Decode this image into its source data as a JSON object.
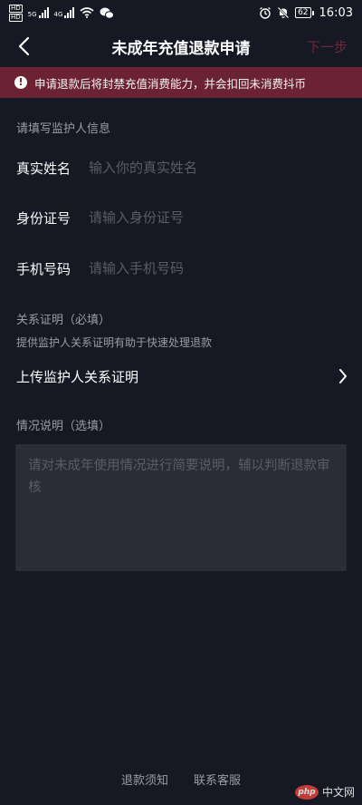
{
  "status_bar": {
    "left_tags": [
      "HD",
      "HD"
    ],
    "network_left": "5G",
    "network_right": "4G",
    "battery": "62",
    "time": "16:03",
    "icons": [
      "signal-icon",
      "wifi-icon",
      "wechat-icon",
      "alarm-icon",
      "mute-icon",
      "battery-icon"
    ]
  },
  "nav": {
    "title": "未成年充值退款申请",
    "next_label": "下一步",
    "back_icon": "chevron-left-icon"
  },
  "warning": {
    "icon": "exclamation-icon",
    "text": "申请退款后将封禁充值消费能力，并会扣回未消费抖币"
  },
  "guardian_section": {
    "title": "请填写监护人信息",
    "fields": [
      {
        "label": "真实姓名",
        "value": "",
        "placeholder": "输入你的真实姓名"
      },
      {
        "label": "身份证号",
        "value": "",
        "placeholder": "请输入身份证号"
      },
      {
        "label": "手机号码",
        "value": "",
        "placeholder": "请输入手机号码"
      }
    ]
  },
  "relation_section": {
    "title": "关系证明（必填）",
    "subtitle": "提供监护人关系证明有助于快速处理退款",
    "upload_label": "上传监护人关系证明",
    "upload_icon": "chevron-right-icon"
  },
  "situation_section": {
    "title": "情况说明（选填）",
    "value": "",
    "placeholder": "请对未成年使用情况进行简要说明，辅以判断退款审核"
  },
  "footer": {
    "refund_notice": "退款须知",
    "contact_service": "联系客服"
  },
  "watermark": {
    "logo": "php",
    "text": "中文网"
  },
  "colors": {
    "background": "#161823",
    "banner": "#6b2232",
    "next_disabled": "#6b2a3a",
    "input_bg": "#2a2c36"
  }
}
